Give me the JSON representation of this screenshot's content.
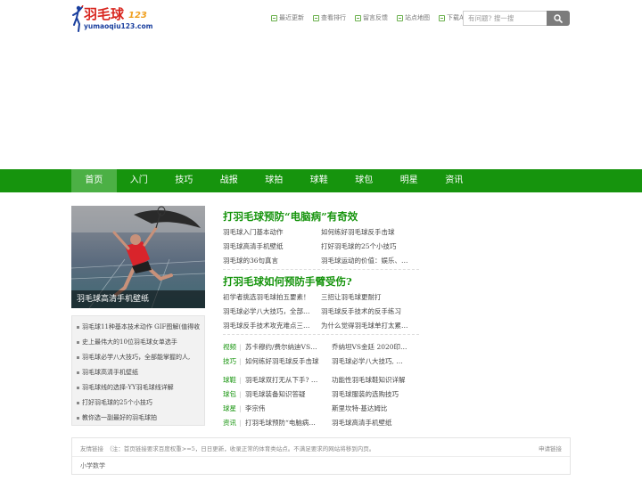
{
  "logo": {
    "text_cn": "羽毛球",
    "text_num": "123",
    "domain": "yumaoqiu123.com"
  },
  "toplinks": [
    {
      "label": "最近更新",
      "icon": "update-icon"
    },
    {
      "label": "查看排行",
      "icon": "ranking-icon"
    },
    {
      "label": "留言反馈",
      "icon": "feedback-icon"
    },
    {
      "label": "站点地图",
      "icon": "sitemap-icon"
    },
    {
      "label": "下载APP",
      "icon": "download-icon"
    }
  ],
  "search": {
    "placeholder": "有问题? 搜一搜",
    "button_icon": "search-icon"
  },
  "nav": {
    "items": [
      "首页",
      "入门",
      "技巧",
      "战报",
      "球拍",
      "球鞋",
      "球包",
      "明星",
      "资讯"
    ],
    "active_index": 0
  },
  "hero": {
    "caption": "羽毛球高清手机壁纸"
  },
  "side_list": [
    "羽毛球11种基本技术动作 GIF图解(值得收",
    "史上最伟大的10位羽毛球女单选手",
    "羽毛球必学八大技巧，全部能掌握的人,",
    "羽毛球高清手机壁纸",
    "羽毛球线的选择-YY羽毛球线详解",
    "打好羽毛球的25个小技巧",
    "教你选一副最好的羽毛球拍"
  ],
  "sections": [
    {
      "title": "打羽毛球预防“电脑病”有奇效",
      "links": [
        "羽毛球入门基本动作",
        "如何练好羽毛球反手击球",
        "羽毛球高清手机壁纸",
        "打好羽毛球的25个小技巧",
        "羽毛球的36句真言",
        "羽毛球运动的价值：娱乐、…"
      ]
    },
    {
      "title": "打羽毛球如何预防手臂受伤?",
      "links": [
        "初学者挑选羽毛球拍五要素！",
        "三招让羽毛球更耐打",
        "羽毛球必学八大技巧，全部…",
        "羽毛球反手技术的反手练习",
        "羽毛球反手技术攻克难点三…",
        "为什么觉得羽毛球单打太累…"
      ]
    }
  ],
  "categories_top": [
    {
      "label": "视频",
      "link1": "苏卡穆约/费尔纳迪VS…",
      "link2": "乔纳坦VS金廷 2020印…"
    },
    {
      "label": "技巧",
      "link1": "如何练好羽毛球反手击球",
      "link2": "羽毛球必学八大技巧, …"
    }
  ],
  "categories_bottom": [
    {
      "label": "球鞋",
      "link1": "羽毛球双打无从下手? …",
      "link2": "功能性羽毛球鞋知识详解"
    },
    {
      "label": "球包",
      "link1": "羽毛球装备知识答疑",
      "link2": "羽毛球服装的选购技巧"
    },
    {
      "label": "球星",
      "link1": "李宗伟",
      "link2": "斯里坎特·基达姆比"
    },
    {
      "label": "资讯",
      "link1": "打羽毛球预防“电脑病…",
      "link2": "羽毛球高清手机壁纸"
    }
  ],
  "friend_links": {
    "header": "友情链接　（注：首页链接要求百度权重>=5，日日更新，收录正常的体育类站点。不满足要求的网站将移到内页。",
    "apply_label": "申请链接",
    "links": [
      "小学数学"
    ]
  },
  "colors": {
    "brand_green": "#16940d",
    "nav_active": "#4cb045",
    "logo_red": "#d8261f",
    "logo_blue": "#1a3f9e"
  }
}
